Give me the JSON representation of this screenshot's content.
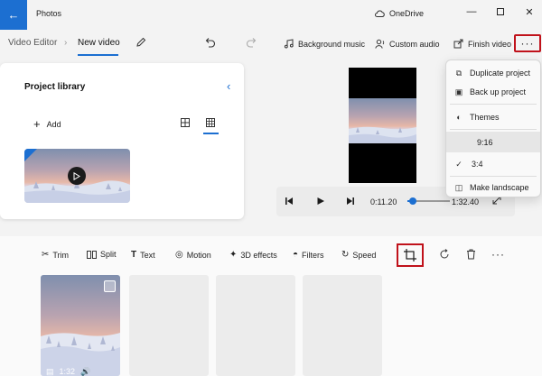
{
  "app": {
    "title": "Photos",
    "cloud_label": "OneDrive"
  },
  "toolbar": {
    "breadcrumb_root": "Video Editor",
    "breadcrumb_current": "New video",
    "background_music": "Background music",
    "custom_audio": "Custom audio",
    "finish_video": "Finish video",
    "more_glyph": "···"
  },
  "library": {
    "title": "Project library",
    "add_label": "Add"
  },
  "player": {
    "current_time": "0:11.20",
    "total_time": "1:32.40",
    "progress": 0.12
  },
  "menu": {
    "items": [
      {
        "label": "Duplicate project",
        "icon": "duplicate-icon"
      },
      {
        "label": "Back up project",
        "icon": "backup-icon"
      },
      {
        "label": "Themes",
        "icon": "themes-icon"
      },
      {
        "label": "9:16",
        "icon": "",
        "selected": true
      },
      {
        "label": "3:4",
        "icon": "check-icon",
        "checked": true
      },
      {
        "label": "Make landscape",
        "icon": "landscape-icon"
      }
    ]
  },
  "storyboard": {
    "tools": [
      "Trim",
      "Split",
      "Text",
      "Motion",
      "3D effects",
      "Filters",
      "Speed"
    ],
    "more_glyph": "···",
    "clip_duration": "1:32"
  },
  "colors": {
    "accent": "#1c6fd1",
    "highlight": "#c0121b"
  }
}
